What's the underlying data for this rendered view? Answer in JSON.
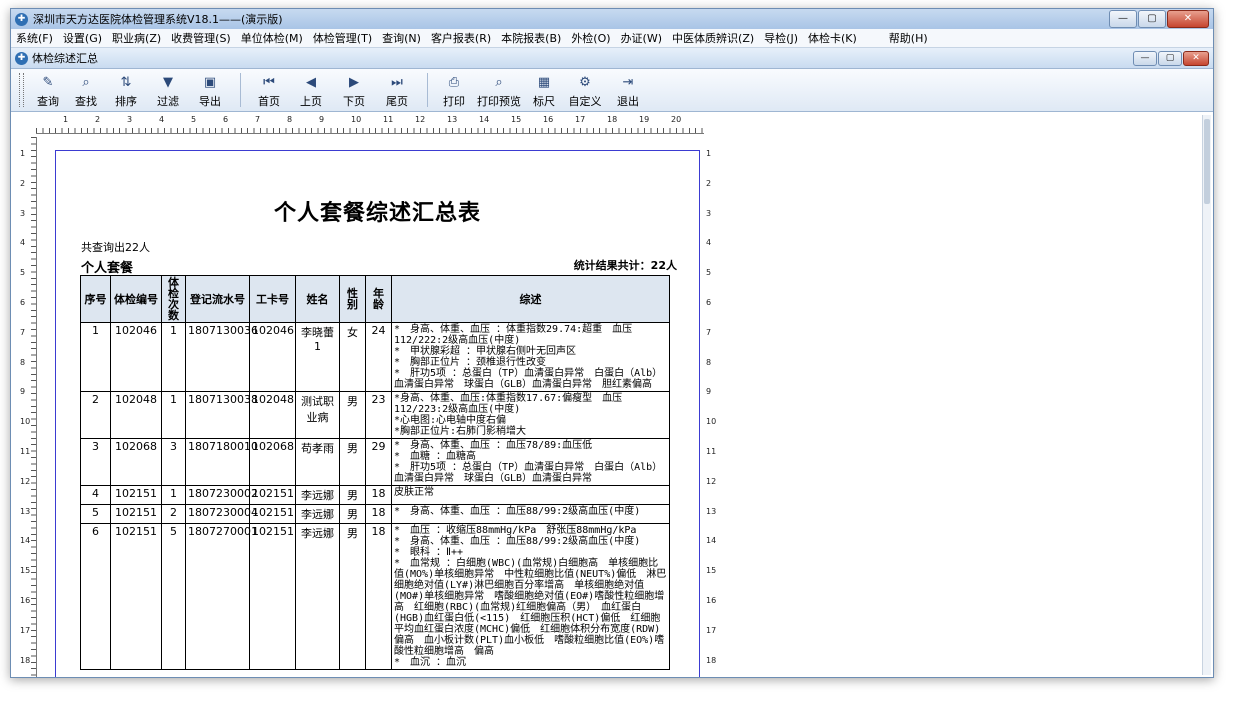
{
  "window": {
    "title": "深圳市天方达医院体检管理系统V18.1——(演示版)",
    "min_label": "—",
    "max_label": "▢",
    "close_label": "✕"
  },
  "menu": [
    "系统(F)",
    "设置(G)",
    "职业病(Z)",
    "收费管理(S)",
    "单位体检(M)",
    "体检管理(T)",
    "查询(N)",
    "客户报表(R)",
    "本院报表(B)",
    "外检(O)",
    "办证(W)",
    "中医体质辨识(Z)",
    "导检(J)",
    "体检卡(K)",
    "帮助(H)"
  ],
  "document": {
    "title": "体检综述汇总"
  },
  "toolbar": [
    {
      "label": "查询",
      "icon": "✎"
    },
    {
      "label": "查找",
      "icon": "⌕"
    },
    {
      "label": "排序",
      "icon": "⇅"
    },
    {
      "label": "过滤",
      "icon": "▼"
    },
    {
      "label": "导出",
      "icon": "▣"
    },
    {
      "label": "首页",
      "icon": "⏮"
    },
    {
      "label": "上页",
      "icon": "◀"
    },
    {
      "label": "下页",
      "icon": "▶"
    },
    {
      "label": "尾页",
      "icon": "⏭"
    },
    {
      "label": "打印",
      "icon": "⎙"
    },
    {
      "label": "打印预览",
      "icon": "⌕"
    },
    {
      "label": "标尺",
      "icon": "▦"
    },
    {
      "label": "自定义",
      "icon": "⚙"
    },
    {
      "label": "退出",
      "icon": "⇥"
    }
  ],
  "ruler": {
    "h": [
      "1",
      "2",
      "3",
      "4",
      "5",
      "6",
      "7",
      "8",
      "9",
      "10",
      "11",
      "12",
      "13",
      "14",
      "15",
      "16",
      "17",
      "18",
      "19",
      "20"
    ],
    "v": [
      "1",
      "2",
      "3",
      "4",
      "5",
      "6",
      "7",
      "8",
      "9",
      "10",
      "11",
      "12",
      "13",
      "14",
      "15",
      "16",
      "17",
      "18"
    ]
  },
  "report": {
    "title": "个人套餐综述汇总表",
    "count": "共查询出22人",
    "section": "个人套餐",
    "total": "统计结果共计：22人",
    "headers": [
      "序号",
      "体检编号",
      "体检次数",
      "登记流水号",
      "工卡号",
      "姓名",
      "性别",
      "年龄",
      "综述"
    ],
    "rows": [
      [
        "1",
        "102046",
        "1",
        "1807130036",
        "102046",
        "李晓蕾1",
        "女",
        "24",
        "*　身高、体重、血压 ：体重指数29.74:超重　血压112/222:2级高血压(中度)\n*　甲状腺彩超 ：甲状腺右侧叶无回声区\n*　胸部正位片 ：颈椎退行性改变\n*　肝功5项 ：总蛋白（TP）血清蛋白异常　白蛋白（Alb）血清蛋白异常　球蛋白（GLB）血清蛋白异常　胆红素偏高"
      ],
      [
        "2",
        "102048",
        "1",
        "1807130038",
        "102048",
        "测试职业病",
        "男",
        "23",
        "*身高、体重、血压:体重指数17.67:偏瘦型　血压112/223:2级高血压(中度)\n*心电图:心电轴中度右偏\n*胸部正位片:右肺门影稍增大"
      ],
      [
        "3",
        "102068",
        "3",
        "1807180010",
        "102068",
        "苟孝雨",
        "男",
        "29",
        "*　身高、体重、血压 ：血压78/89:血压低\n*　血糖 ：血糖高\n*　肝功5项 ：总蛋白（TP）血清蛋白异常　白蛋白（Alb）血清蛋白异常　球蛋白（GLB）血清蛋白异常"
      ],
      [
        "4",
        "102151",
        "1",
        "1807230002",
        "102151",
        "李远娜",
        "男",
        "18",
        "皮肤正常"
      ],
      [
        "5",
        "102151",
        "2",
        "1807230004",
        "102151",
        "李远娜",
        "男",
        "18",
        "*　身高、体重、血压 ：血压88/99:2级高血压(中度)"
      ],
      [
        "6",
        "102151",
        "5",
        "1807270001",
        "102151",
        "李远娜",
        "男",
        "18",
        "*　血压 ：收缩压88mmHg/kPa　舒张压88mmHg/kPa\n*　身高、体重、血压 ：血压88/99:2级高血压(中度)\n*　眼科 ：Ⅱ++\n*　血常规 ：白细胞(WBC)(血常规)白细胞高　单核细胞比值(MO%)单核细胞异常　中性粒细胞比值(NEUT%)偏低　淋巴细胞绝对值(LY#)淋巴细胞百分率增高　单核细胞绝对值(MO#)单核细胞异常　嗜酸细胞绝对值(EO#)嗜酸性粒细胞增高　红细胞(RBC)(血常规)红细胞偏高（男）　血红蛋白(HGB)血红蛋白低(<115)　红细胞压积(HCT)偏低　红细胞平均血红蛋白浓度(MCHC)偏低　红细胞体积分布宽度(RDW)偏高　血小板计数(PLT)血小板低　嗜酸粒细胞比值(EO%)嗜酸性粒细胞增高　偏高\n*　血沉 ：血沉"
      ]
    ]
  }
}
